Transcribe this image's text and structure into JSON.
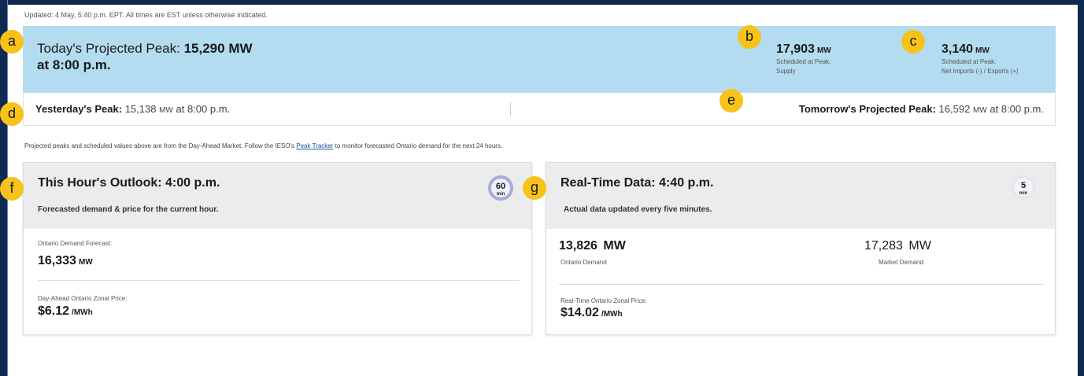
{
  "updated": "Updated: 4 May, 5:40 p.m. EPT. All times are EST unless otherwise indicated.",
  "peak": {
    "title_prefix": "Today's Projected Peak:",
    "title_value": "15,290 MW",
    "time": "at 8:00 p.m."
  },
  "supply": {
    "value": "17,903",
    "unit": "MW",
    "label1": "Scheduled at Peak:",
    "label2": "Supply"
  },
  "net": {
    "value": "3,140",
    "unit": "MW",
    "label1": "Scheduled at Peak:",
    "label2": "Net Imports (-) / Exports (+)"
  },
  "yesterday": {
    "label": "Yesterday's Peak:",
    "value": "15,138",
    "unit": "MW",
    "time": "at 8:00 p.m."
  },
  "tomorrow": {
    "label": "Tomorrow's Projected Peak:",
    "value": "16,592",
    "unit": "MW",
    "time": "at 8:00 p.m."
  },
  "note": {
    "before": "Projected peaks and scheduled values above are from the Day-Ahead Market.  Follow the IESO's ",
    "link": "Peak Tracker",
    "after": " to monitor forecasted Ontario demand for the next 24 hours."
  },
  "outlook": {
    "title": "This Hour's Outlook: 4:00 p.m.",
    "subtitle": "Forecasted demand & price for the current hour.",
    "badge_num": "60",
    "badge_unit": "min",
    "demand_label": "Ontario Demand Forecast:",
    "demand_value": "16,333",
    "demand_unit": "MW",
    "price_label": "Day-Ahead Ontario Zonal Price:",
    "price_value": "$6.12",
    "price_unit": "/MWh"
  },
  "realtime": {
    "title": "Real-Time Data: 4:40 p.m.",
    "subtitle": "Actual data updated every five minutes.",
    "badge_num": "5",
    "badge_unit": "min",
    "ontario_value": "13,826",
    "ontario_unit": "MW",
    "ontario_label": "Ontario Demand",
    "market_value": "17,283",
    "market_unit": "MW",
    "market_label": "Market Demand",
    "price_label": "Real-Time Ontario Zonal Price:",
    "price_value": "$14.02",
    "price_unit": "/MWh"
  },
  "callouts": {
    "a": "a",
    "b": "b",
    "c": "c",
    "d": "d",
    "e": "e",
    "f": "f",
    "g": "g"
  },
  "colors": {
    "navy": "#0e2a52",
    "peak_bg": "#b3dcf1",
    "callout": "#f7c21a",
    "card_head": "#ececec"
  }
}
